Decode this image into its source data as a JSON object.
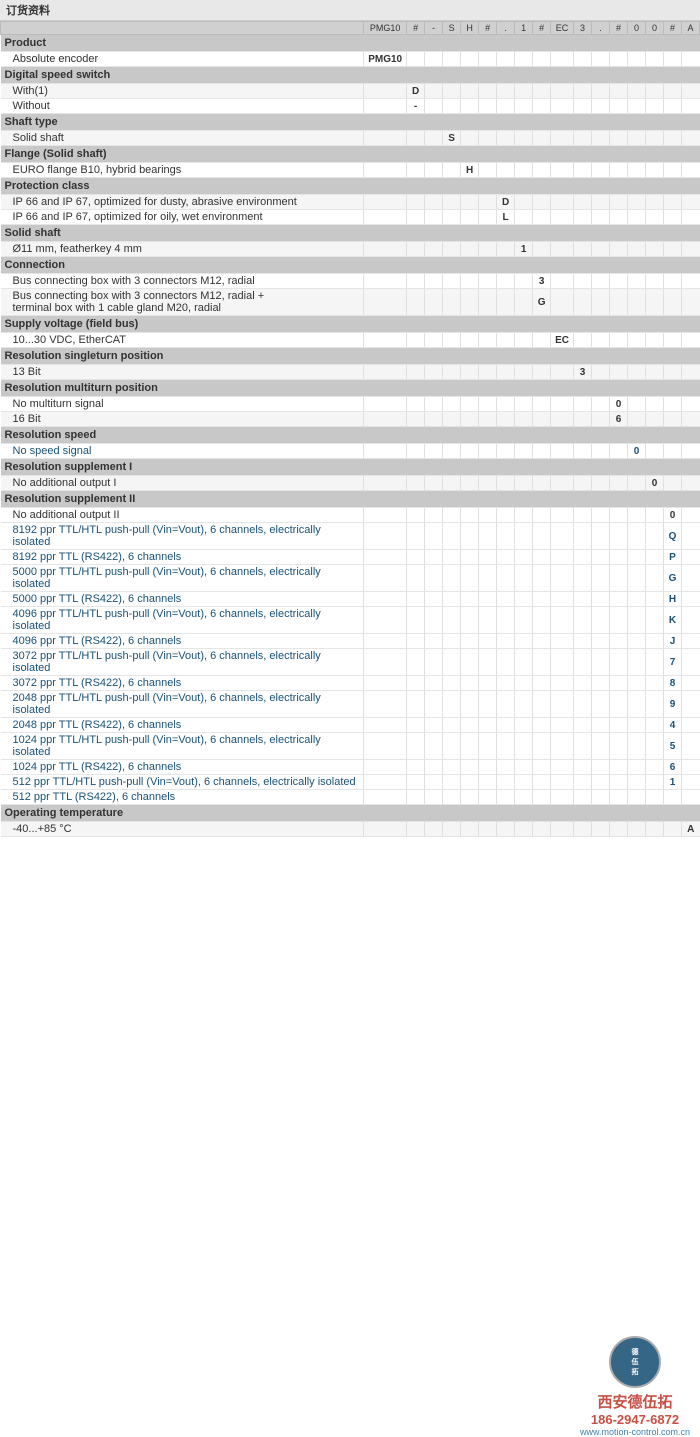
{
  "page": {
    "title": "订货资料",
    "header_codes": [
      "PMG10",
      "#",
      "-",
      "S",
      "H",
      "#",
      ".",
      "1",
      "#",
      "EC",
      "3",
      ".",
      "#",
      "0",
      "0",
      "#",
      "A"
    ]
  },
  "sections": [
    {
      "id": "product",
      "header": "Product",
      "rows": [
        {
          "label": "Absolute encoder",
          "code": "PMG10",
          "col": 0,
          "bg": "odd"
        }
      ]
    },
    {
      "id": "digital-speed-switch",
      "header": "Digital speed switch",
      "rows": [
        {
          "label": "With(1)",
          "code": "D",
          "col": 1,
          "bg": "even"
        },
        {
          "label": "Without",
          "code": "-",
          "col": 1,
          "bg": "odd"
        }
      ]
    },
    {
      "id": "shaft-type",
      "header": "Shaft type",
      "rows": [
        {
          "label": "Solid shaft",
          "code": "S",
          "col": 3,
          "bg": "even"
        }
      ]
    },
    {
      "id": "flange",
      "header": "Flange (Solid shaft)",
      "rows": [
        {
          "label": "EURO flange B10, hybrid bearings",
          "code": "H",
          "col": 4,
          "bg": "odd"
        }
      ]
    },
    {
      "id": "protection",
      "header": "Protection class",
      "rows": [
        {
          "label": "IP 66 and IP 67, optimized for dusty, abrasive environment",
          "code": "D",
          "col": 6,
          "bg": "even"
        },
        {
          "label": "IP 66 and IP 67, optimized for oily, wet environment",
          "code": "L",
          "col": 6,
          "bg": "odd"
        }
      ]
    },
    {
      "id": "solid-shaft",
      "header": "Solid shaft",
      "rows": [
        {
          "label": "Ø11 mm, featherkey 4 mm",
          "code": "1",
          "col": 7,
          "bg": "even"
        }
      ]
    },
    {
      "id": "connection",
      "header": "Connection",
      "rows": [
        {
          "label": "Bus connecting box with 3 connectors M12, radial",
          "code": "3",
          "col": 8,
          "bg": "odd"
        },
        {
          "label": "Bus connecting box with 3 connectors M12, radial +\nterminal box with 1 cable gland M20, radial",
          "code": "G",
          "col": 8,
          "bg": "even"
        }
      ]
    },
    {
      "id": "supply-voltage",
      "header": "Supply voltage (field bus)",
      "rows": [
        {
          "label": "10...30 VDC, EtherCAT",
          "code": "EC",
          "col": 9,
          "bg": "odd"
        }
      ]
    },
    {
      "id": "resolution-singleturn",
      "header": "Resolution singleturn position",
      "rows": [
        {
          "label": "13 Bit",
          "code": "3",
          "col": 10,
          "bg": "even"
        }
      ]
    },
    {
      "id": "resolution-multiturn",
      "header": "Resolution multiturn position",
      "rows": [
        {
          "label": "No multiturn signal",
          "code": "0",
          "col": 12,
          "bg": "odd"
        },
        {
          "label": "16 Bit",
          "code": "6",
          "col": 12,
          "bg": "even"
        }
      ]
    },
    {
      "id": "resolution-speed",
      "header": "Resolution speed",
      "rows": [
        {
          "label": "No speed signal",
          "code": "0",
          "col": 13,
          "bg": "odd",
          "blue": true
        }
      ]
    },
    {
      "id": "resolution-supplement-1",
      "header": "Resolution supplement I",
      "rows": [
        {
          "label": "No additional output I",
          "code": "0",
          "col": 14,
          "bg": "even"
        }
      ]
    },
    {
      "id": "resolution-supplement-2",
      "header": "Resolution supplement II",
      "rows": [
        {
          "label": "No additional output II",
          "code": "0",
          "col": 15,
          "bg": "odd"
        },
        {
          "label": "8192 ppr TTL/HTL push-pull (Vin=Vout), 6 channels, electrically isolated",
          "code": "Q",
          "col": 15,
          "bg": "even",
          "blue": true
        },
        {
          "label": "8192 ppr TTL (RS422), 6 channels",
          "code": "P",
          "col": 15,
          "bg": "odd",
          "blue": true
        },
        {
          "label": "5000 ppr TTL/HTL push-pull (Vin=Vout), 6 channels, electrically isolated",
          "code": "G",
          "col": 15,
          "bg": "even",
          "blue": true
        },
        {
          "label": "5000 ppr TTL (RS422), 6 channels",
          "code": "H",
          "col": 15,
          "bg": "odd",
          "blue": true
        },
        {
          "label": "4096 ppr TTL/HTL push-pull (Vin=Vout), 6 channels, electrically isolated",
          "code": "K",
          "col": 15,
          "bg": "even",
          "blue": true
        },
        {
          "label": "4096 ppr TTL (RS422), 6 channels",
          "code": "J",
          "col": 15,
          "bg": "odd",
          "blue": true
        },
        {
          "label": "3072 ppr TTL/HTL push-pull (Vin=Vout), 6 channels, electrically isolated",
          "code": "7",
          "col": 15,
          "bg": "even",
          "blue": true
        },
        {
          "label": "3072 ppr TTL (RS422), 6 channels",
          "code": "8",
          "col": 15,
          "bg": "odd",
          "blue": true
        },
        {
          "label": "2048 ppr TTL/HTL push-pull (Vin=Vout), 6 channels, electrically isolated",
          "code": "9",
          "col": 15,
          "bg": "even",
          "blue": true
        },
        {
          "label": "2048 ppr TTL (RS422), 6 channels",
          "code": "4",
          "col": 15,
          "bg": "odd",
          "blue": true
        },
        {
          "label": "1024 ppr TTL/HTL push-pull (Vin=Vout), 6 channels, electrically isolated",
          "code": "5",
          "col": 15,
          "bg": "even",
          "blue": true
        },
        {
          "label": "1024 ppr TTL (RS422), 6 channels",
          "code": "6",
          "col": 15,
          "bg": "odd",
          "blue": true
        },
        {
          "label": "512 ppr TTL/HTL push-pull (Vin=Vout), 6 channels, electrically isolated",
          "code": "1",
          "col": 15,
          "bg": "even",
          "blue": true
        },
        {
          "label": "512 ppr TTL (RS422), 6 channels",
          "code": "",
          "col": 15,
          "bg": "odd",
          "blue": true
        }
      ]
    },
    {
      "id": "operating-temp",
      "header": "Operating temperature",
      "rows": [
        {
          "label": "-40...+85 °C",
          "code": "A",
          "col": 16,
          "bg": "even"
        }
      ]
    }
  ],
  "watermark": {
    "brand": "西安德伍拓",
    "phone": "186-2947-6872",
    "url": "www.motion-control.com.cn"
  },
  "col_headers": [
    "PMG10",
    "#",
    "-",
    "S",
    "H",
    "#",
    ".",
    "1",
    "#",
    "EC",
    "3",
    ".",
    "#",
    "0",
    "0",
    "#",
    "A"
  ]
}
